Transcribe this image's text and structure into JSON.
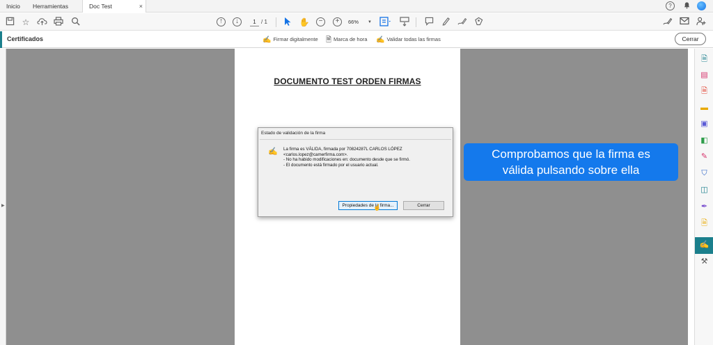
{
  "tabs": {
    "home": "Inicio",
    "tools": "Herramientas",
    "document": "Doc Test FIRMADO...",
    "close_glyph": "×"
  },
  "window_controls": {
    "help": "?",
    "notifications_icon": "bell-icon",
    "avatar_icon": "user-avatar"
  },
  "toolbar": {
    "current_page": "1",
    "page_total": "/ 1",
    "zoom": "66%",
    "icons": [
      "save-icon",
      "bookmark-star-icon",
      "upload-cloud-icon",
      "print-icon",
      "find-icon",
      "prev-page-icon",
      "next-page-icon",
      "select-cursor-icon",
      "hand-icon",
      "zoom-out-icon",
      "zoom-in-icon",
      "page-fit-icon",
      "scroll-mode-icon",
      "comment-icon",
      "highlight-pen-icon",
      "sign-icon",
      "stamp-icon",
      "share-icon",
      "email-icon",
      "add-user-icon"
    ]
  },
  "cert_bar": {
    "title": "Certificados",
    "sign_digitally": "Firmar digitalmente",
    "timestamp": "Marca de hora",
    "validate_all": "Validar todas las firmas",
    "close": "Cerrar"
  },
  "document": {
    "title": "DOCUMENTO TEST ORDEN FIRMAS"
  },
  "dialog": {
    "title": "Estado de validación de la firma",
    "lines": [
      "La firma es VÁLIDA, firmada por 70824287L CARLOS LÓPEZ",
      "<carlos.lopez@camerfirma.com>.",
      "- No ha habido modificaciones en: documento desde que se firmó.",
      "- El documento está firmado por el usuario actual."
    ],
    "properties_button": "Propiedades de la firma...",
    "close_button": "Cerrar"
  },
  "callout": {
    "line1": "Comprobamos que la firma es",
    "line2": "válida pulsando sobre ella"
  },
  "colors": {
    "accent_teal": "#1b7f8c",
    "callout_blue": "#1479ec",
    "adobe_blue": "#1473e6",
    "canvas_gray": "#8f8f8f"
  }
}
